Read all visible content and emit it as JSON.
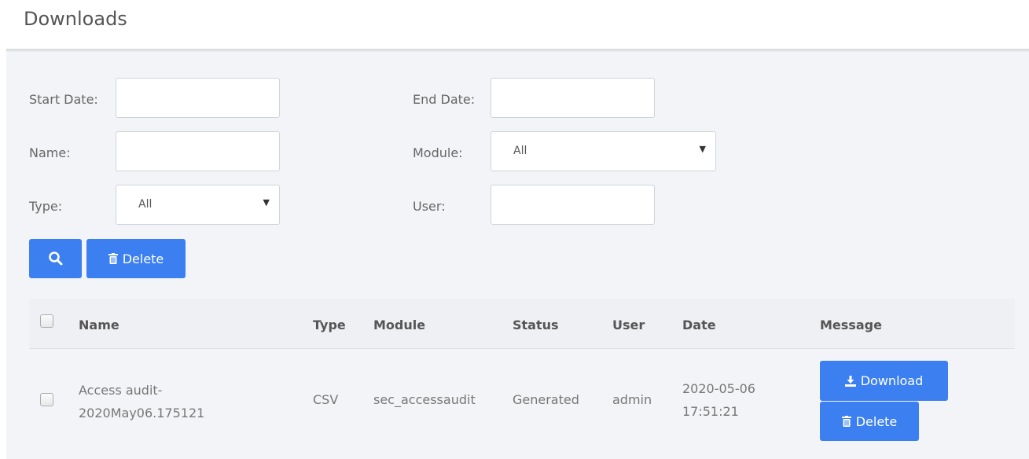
{
  "header": {
    "title": "Downloads"
  },
  "filters": {
    "start_date": {
      "label": "Start Date:",
      "value": ""
    },
    "end_date": {
      "label": "End Date:",
      "value": ""
    },
    "name": {
      "label": "Name:",
      "value": ""
    },
    "module": {
      "label": "Module:",
      "selected": "All"
    },
    "type": {
      "label": "Type:",
      "selected": "All"
    },
    "user": {
      "label": "User:",
      "value": ""
    }
  },
  "actions": {
    "delete_label": "Delete"
  },
  "table": {
    "columns": [
      "Name",
      "Type",
      "Module",
      "Status",
      "User",
      "Date",
      "Message"
    ],
    "rows": [
      {
        "name_line1": "Access audit-",
        "name_line2": "2020May06.175121",
        "type": "CSV",
        "module": "sec_accessaudit",
        "status": "Generated",
        "user": "admin",
        "date_line1": "2020-05-06",
        "date_line2": "17:51:21",
        "download_label": "Download",
        "delete_label": "Delete"
      }
    ]
  },
  "colors": {
    "primary": "#3b7ff0",
    "background": "#f2f4f7",
    "header_bg": "#eef0f4"
  }
}
